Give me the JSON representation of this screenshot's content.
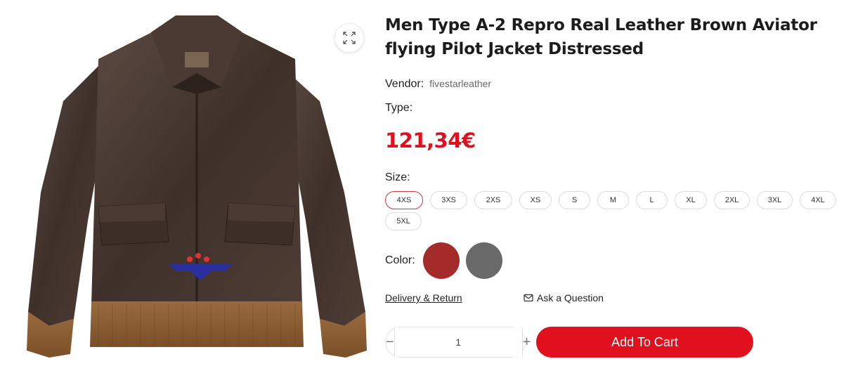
{
  "product": {
    "title": "Men Type A-2 Repro Real Leather Brown Aviator flying Pilot Jacket Distressed",
    "vendor_label": "Vendor:",
    "vendor_value": "fivestarleather",
    "type_label": "Type:",
    "price": "121,34€"
  },
  "gallery": {
    "image_alt": "Brown leather A-2 aviator jacket",
    "zoom_icon": "expand-icon"
  },
  "size": {
    "label": "Size:",
    "selected": "4XS",
    "options": [
      "4XS",
      "3XS",
      "2XS",
      "XS",
      "S",
      "M",
      "L",
      "XL",
      "2XL",
      "3XL",
      "4XL",
      "5XL"
    ]
  },
  "color": {
    "label": "Color:",
    "swatches": [
      {
        "name": "red",
        "hex": "#a52a2a"
      },
      {
        "name": "gray",
        "hex": "#696969"
      }
    ]
  },
  "links": {
    "delivery": "Delivery & Return",
    "ask": "Ask a Question",
    "ask_icon": "envelope-icon"
  },
  "cart": {
    "quantity": "1",
    "minus": "−",
    "plus": "+",
    "add_label": "Add To Cart",
    "accent": "#e0101f"
  }
}
